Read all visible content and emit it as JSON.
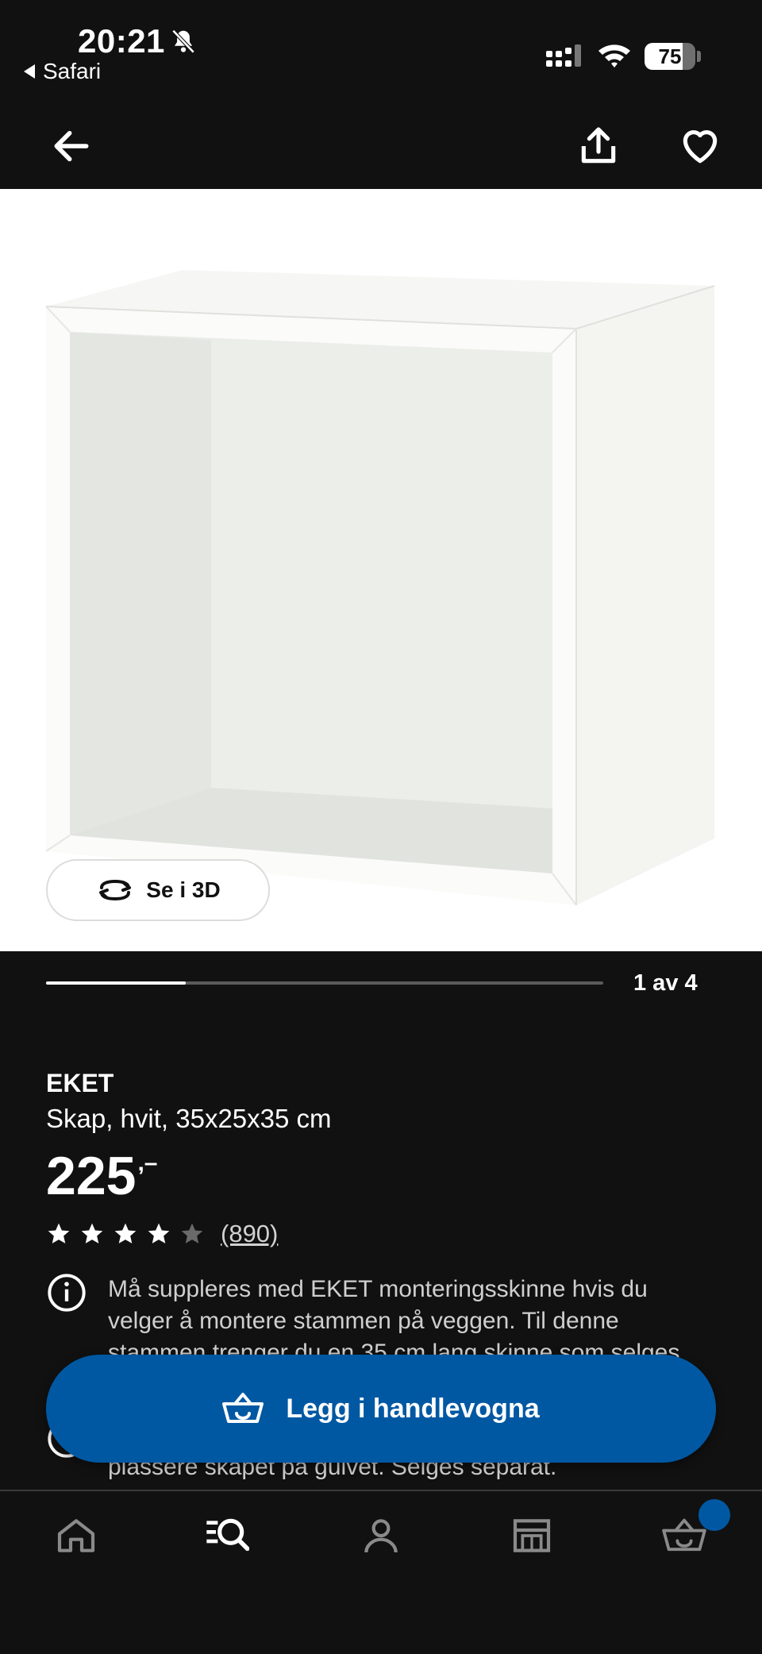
{
  "status_bar": {
    "time": "20:21",
    "back_app": "Safari",
    "battery_percent": "75",
    "battery_level": 0.75
  },
  "header": {
    "back_icon": "arrow-left-icon",
    "share_icon": "share-icon",
    "wishlist_icon": "heart-icon"
  },
  "gallery": {
    "view_3d_label": "Se i 3D",
    "position_label": "1 av 4",
    "progress_fraction": 0.25
  },
  "product": {
    "name": "EKET",
    "description": "Skap, hvit, 35x25x35 cm",
    "price": "225",
    "price_suffix": ",–",
    "rating": 4,
    "rating_max": 5,
    "review_count": "(890)",
    "notice": "Må suppleres med EKET monteringsskinne hvis du velger å montere stammen på veggen. Til denne stammen trenger du en 35 cm lang skinne som selges",
    "notice_2": "plassere skapet på gulvet. Selges separat."
  },
  "cta": {
    "add_to_cart": "Legg i handlevogna"
  },
  "bottom_nav": {
    "items": [
      "home-icon",
      "search-icon",
      "profile-icon",
      "store-icon",
      "cart-icon"
    ]
  },
  "colors": {
    "brand_blue": "#0058a3",
    "background": "#111111"
  }
}
